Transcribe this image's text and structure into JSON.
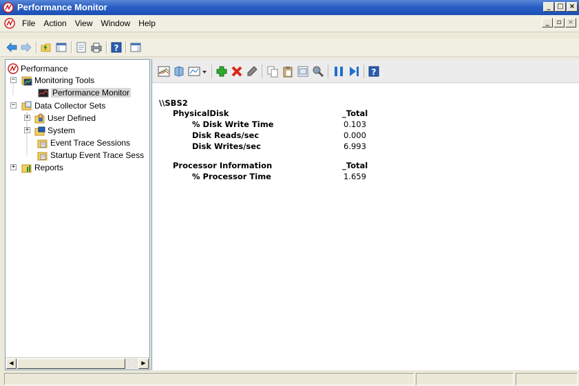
{
  "window": {
    "title": "Performance Monitor",
    "minimize_glyph": "_",
    "maximize_glyph": "□",
    "close_glyph": "×",
    "restore_glyph": "▫"
  },
  "menu": {
    "items": [
      "File",
      "Action",
      "View",
      "Window",
      "Help"
    ]
  },
  "toolbar": {
    "icons": [
      "back-arrow-icon",
      "forward-arrow-icon",
      "up-folder-icon",
      "show-hide-tree-icon",
      "properties-icon",
      "print-icon",
      "help-icon",
      "action-pane-icon"
    ]
  },
  "tree": {
    "root": "Performance",
    "items": [
      {
        "label": "Monitoring Tools",
        "expander": "−"
      },
      {
        "label": "Performance Monitor"
      },
      {
        "label": "Data Collector Sets",
        "expander": "−"
      },
      {
        "label": "User Defined",
        "expander": "+"
      },
      {
        "label": "System",
        "expander": "+"
      },
      {
        "label": "Event Trace Sessions"
      },
      {
        "label": "Startup Event Trace Sess"
      },
      {
        "label": "Reports",
        "expander": "+"
      }
    ]
  },
  "graph_toolbar": {
    "icons": [
      "change-graph-type-icon",
      "freeze-display-icon",
      "view-type-icon",
      "dropdown-arrow-icon",
      "add-counter-icon",
      "delete-counter-icon",
      "highlight-icon",
      "copy-icon",
      "paste-icon",
      "properties-icon",
      "zoom-icon",
      "pause-icon",
      "update-data-icon",
      "help-icon"
    ]
  },
  "report": {
    "machine": "\\\\SBS2",
    "sections": [
      {
        "object": "PhysicalDisk",
        "instance": "_Total",
        "counters": [
          {
            "name": "% Disk Write Time",
            "value": "0.103"
          },
          {
            "name": "Disk Reads/sec",
            "value": "0.000"
          },
          {
            "name": "Disk Writes/sec",
            "value": "6.993"
          }
        ]
      },
      {
        "object": "Processor Information",
        "instance": "_Total",
        "counters": [
          {
            "name": "% Processor Time",
            "value": "1.659"
          }
        ]
      }
    ]
  },
  "colors": {
    "title_bar": "#2b5fc4",
    "add_icon": "#2fa82f",
    "delete_icon": "#d9261c",
    "pause_icon": "#1f6fd1"
  }
}
